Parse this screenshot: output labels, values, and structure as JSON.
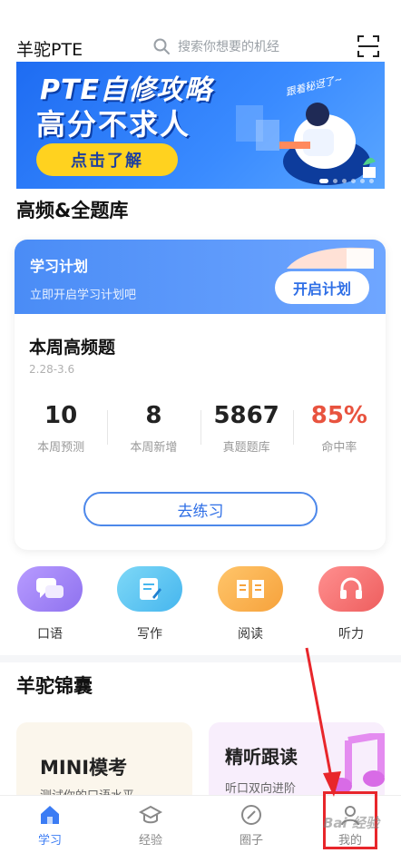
{
  "header": {
    "app_title": "羊驼PTE",
    "search_placeholder": "搜索你想要的机经"
  },
  "banner": {
    "line1": "PTE自修攻略",
    "line2": "高分不求人",
    "cta": "点击了解",
    "script_text": "跟着秘迓了~"
  },
  "section_question_bank": {
    "title": "高频&全题库"
  },
  "study_plan": {
    "title": "学习计划",
    "subtitle": "立即开启学习计划吧",
    "button": "开启计划"
  },
  "weekly": {
    "title": "本周高频题",
    "date_range": "2.28-3.6",
    "stats": [
      {
        "value": "10",
        "label": "本周预测"
      },
      {
        "value": "8",
        "label": "本周新增"
      },
      {
        "value": "5867",
        "label": "真题题库"
      },
      {
        "value": "85%",
        "label": "命中率"
      }
    ],
    "practice_button": "去练习"
  },
  "skills": [
    {
      "label": "口语",
      "icon": "chat-icon",
      "color": "#a78bf5"
    },
    {
      "label": "写作",
      "icon": "edit-icon",
      "color": "#5cc6f2"
    },
    {
      "label": "阅读",
      "icon": "book-icon",
      "color": "#f7b14c"
    },
    {
      "label": "听力",
      "icon": "headphones-icon",
      "color": "#f26c6c"
    }
  ],
  "section_treasures": {
    "title": "羊驼锦囊"
  },
  "treasure_cards": [
    {
      "title": "MINI模考",
      "subtitle": "测试你的口语水平"
    },
    {
      "title": "精听跟读",
      "subtitle": "听口双向进阶"
    }
  ],
  "bottom_nav": [
    {
      "label": "学习",
      "icon": "home-icon",
      "active": true
    },
    {
      "label": "经验",
      "icon": "graduation-cap-icon",
      "active": false
    },
    {
      "label": "圈子",
      "icon": "compass-icon",
      "active": false
    },
    {
      "label": "我的",
      "icon": "user-icon",
      "active": false
    }
  ],
  "watermark": "Bai 经验"
}
